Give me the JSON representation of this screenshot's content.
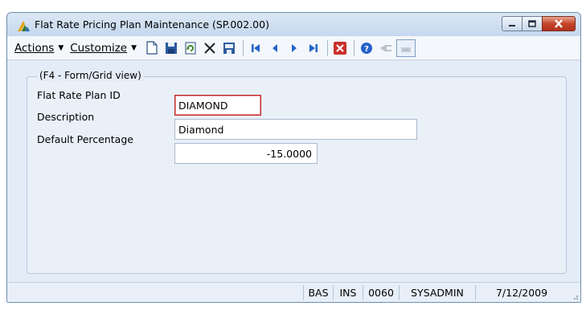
{
  "window": {
    "title": "Flat Rate Pricing Plan Maintenance (SP.002.00)"
  },
  "menu": {
    "actions_label": "Actions",
    "customize_label": "Customize"
  },
  "toolbar": {
    "icons": [
      "new-icon",
      "save-icon",
      "refresh-icon",
      "delete-icon",
      "save-all-icon",
      "first-record-icon",
      "previous-record-icon",
      "next-record-icon",
      "last-record-icon",
      "close-form-icon",
      "help-icon",
      "customize-icon",
      "grid-view-icon"
    ]
  },
  "form": {
    "group_label": "(F4 - Form/Grid view)",
    "plan_id_label": "Flat Rate Plan ID",
    "plan_id_value": "DIAMOND",
    "description_label": "Description",
    "description_value": "Diamond",
    "default_percentage_label": "Default Percentage",
    "default_percentage_value": "-15.0000"
  },
  "status": {
    "mode": "BAS",
    "insert": "INS",
    "company": "0060",
    "user": "SYSADMIN",
    "date": "7/12/2009"
  },
  "colors": {
    "focus_border": "#c0282d",
    "close_button": "#c4452c",
    "title_gradient_top": "#dbe7f5"
  }
}
